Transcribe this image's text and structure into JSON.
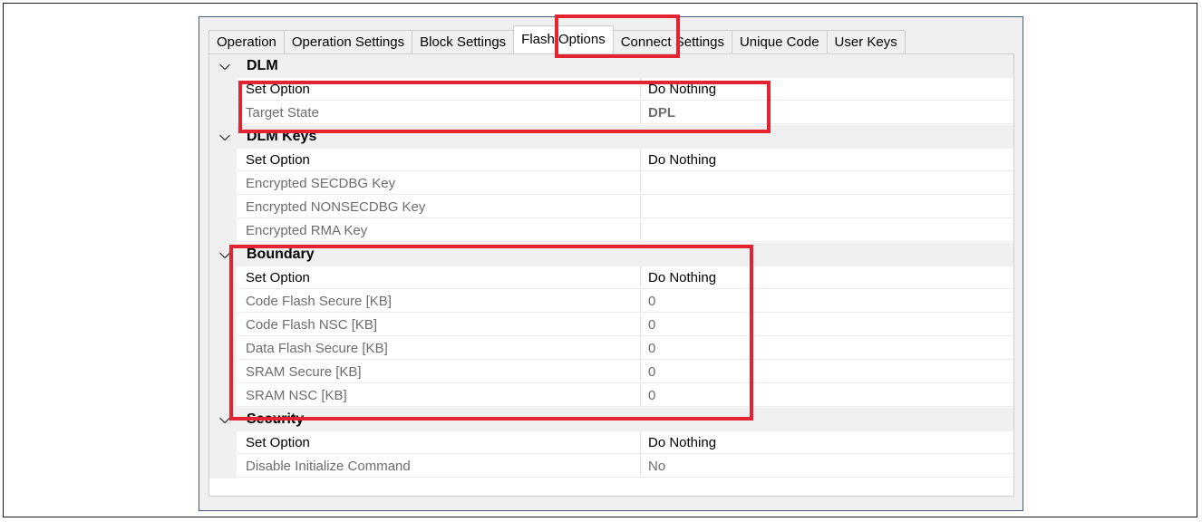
{
  "tabs": [
    {
      "label": "Operation",
      "active": false
    },
    {
      "label": "Operation Settings",
      "active": false
    },
    {
      "label": "Block Settings",
      "active": false
    },
    {
      "label": "Flash Options",
      "active": true
    },
    {
      "label": "Connect Settings",
      "active": false
    },
    {
      "label": "Unique Code",
      "active": false
    },
    {
      "label": "User Keys",
      "active": false
    }
  ],
  "grid": {
    "dlm": {
      "title": "DLM",
      "set_option": {
        "name": "Set Option",
        "value": "Do Nothing"
      },
      "target_state": {
        "name": "Target State",
        "value": "DPL"
      }
    },
    "dlm_keys": {
      "title": "DLM Keys",
      "set_option": {
        "name": "Set Option",
        "value": "Do Nothing"
      },
      "secdbg": {
        "name": "Encrypted SECDBG Key",
        "value": ""
      },
      "nonsecdbg": {
        "name": "Encrypted NONSECDBG Key",
        "value": ""
      },
      "rma": {
        "name": "Encrypted RMA Key",
        "value": ""
      }
    },
    "boundary": {
      "title": "Boundary",
      "set_option": {
        "name": "Set Option",
        "value": "Do Nothing"
      },
      "code_flash_secure": {
        "name": "Code Flash Secure [KB]",
        "value": "0"
      },
      "code_flash_nsc": {
        "name": "Code Flash NSC [KB]",
        "value": "0"
      },
      "data_flash_secure": {
        "name": "Data Flash Secure [KB]",
        "value": "0"
      },
      "sram_secure": {
        "name": "SRAM Secure [KB]",
        "value": "0"
      },
      "sram_nsc": {
        "name": "SRAM NSC [KB]",
        "value": "0"
      }
    },
    "security": {
      "title": "Security",
      "set_option": {
        "name": "Set Option",
        "value": "Do Nothing"
      },
      "disable_init": {
        "name": "Disable Initialize Command",
        "value": "No"
      }
    }
  },
  "colors": {
    "highlight": "#e32232",
    "window_border": "#4a5a86",
    "readonly_text": "#6d6d6d"
  },
  "icons": {
    "collapse": "chevron-down-icon"
  }
}
